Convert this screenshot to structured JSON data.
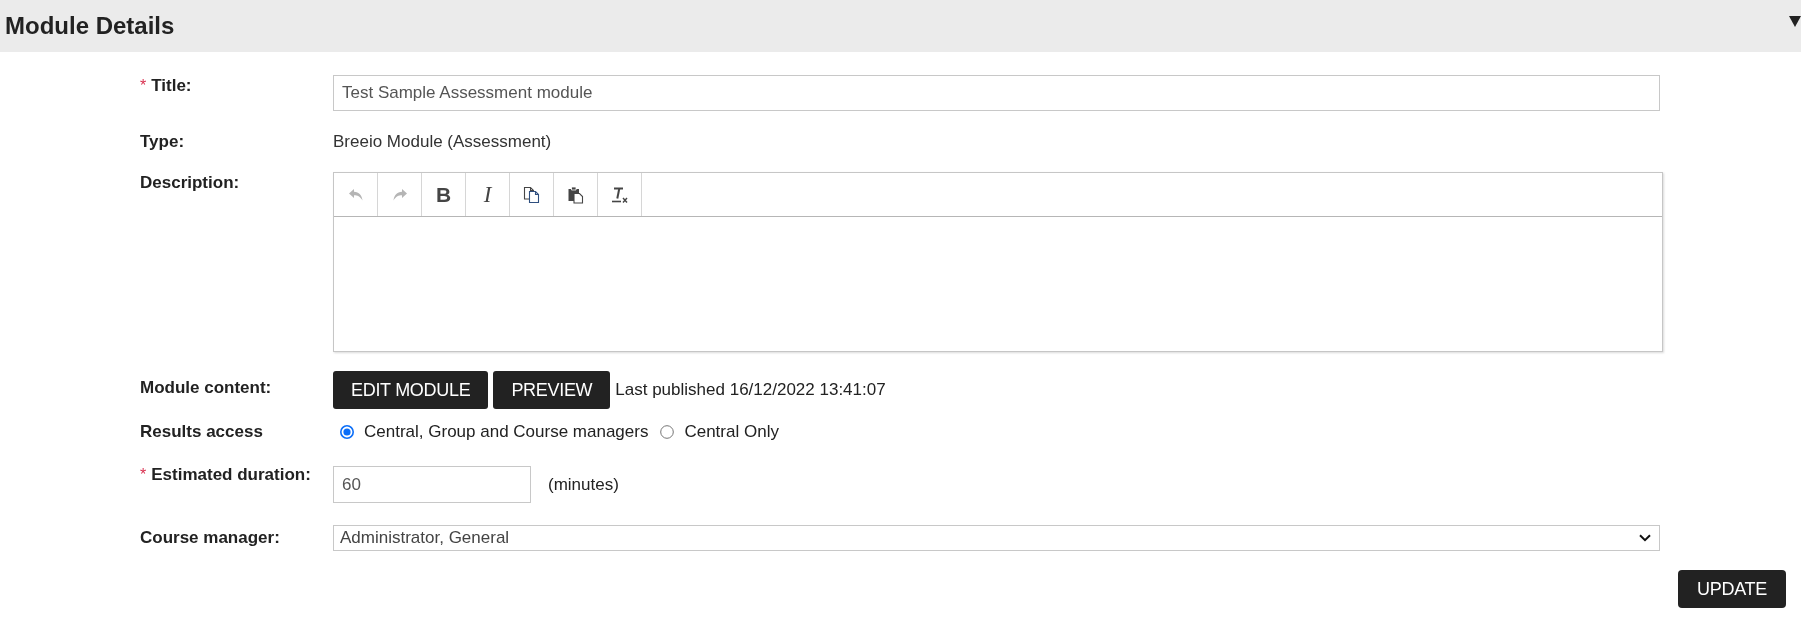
{
  "section": {
    "title": "Module Details"
  },
  "form": {
    "title": {
      "required_mark": "*",
      "label": "Title:",
      "value": "Test Sample Assessment module"
    },
    "type": {
      "label": "Type:",
      "value": "Breeio Module (Assessment)"
    },
    "description": {
      "label": "Description:",
      "toolbar": [
        {
          "kind": "undo",
          "disabled": true
        },
        {
          "kind": "redo",
          "disabled": true
        },
        {
          "kind": "bold",
          "label": "B",
          "disabled": false
        },
        {
          "kind": "italic",
          "label": "I",
          "disabled": false
        },
        {
          "kind": "copy",
          "disabled": false
        },
        {
          "kind": "paste",
          "disabled": false
        },
        {
          "kind": "remove_format",
          "disabled": false
        }
      ]
    },
    "module_content": {
      "label": "Module content:",
      "buttons": [
        "EDIT MODULE",
        "PREVIEW"
      ],
      "published_note": "Last published 16/12/2022 13:41:07"
    },
    "results_access": {
      "label": "Results access",
      "options": [
        {
          "label": "Central, Group and Course managers",
          "selected": true
        },
        {
          "label": "Central Only",
          "selected": false
        }
      ]
    },
    "estimated_duration": {
      "required_mark": "*",
      "label": "Estimated duration:",
      "value": "60",
      "unit": "(minutes)"
    },
    "course_manager": {
      "label": "Course manager:",
      "value": "Administrator, General"
    }
  },
  "actions": {
    "update_button": "UPDATE"
  }
}
